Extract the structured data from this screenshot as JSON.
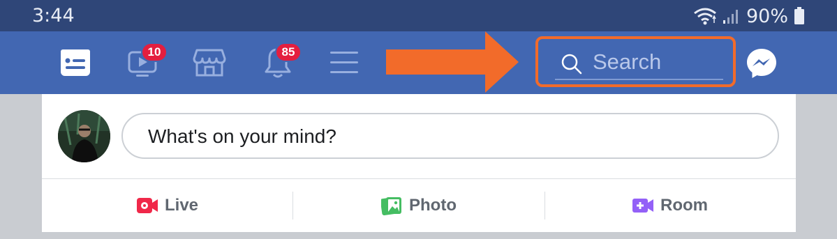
{
  "status_bar": {
    "time": "3:44",
    "battery_percent": "90%"
  },
  "nav": {
    "videos_badge": "10",
    "notifications_badge": "85",
    "search_placeholder": "Search"
  },
  "composer": {
    "placeholder": "What's on your mind?"
  },
  "actions": [
    {
      "label": "Live",
      "icon": "live-video-icon",
      "color": "#f02849"
    },
    {
      "label": "Photo",
      "icon": "photo-icon",
      "color": "#45bd62"
    },
    {
      "label": "Room",
      "icon": "room-video-icon",
      "color": "#9360f7"
    }
  ],
  "colors": {
    "status_bar": "#2f4678",
    "nav_bar": "#4267b2",
    "highlight_orange": "#f26b2a",
    "badge_red": "#e41e3f"
  }
}
